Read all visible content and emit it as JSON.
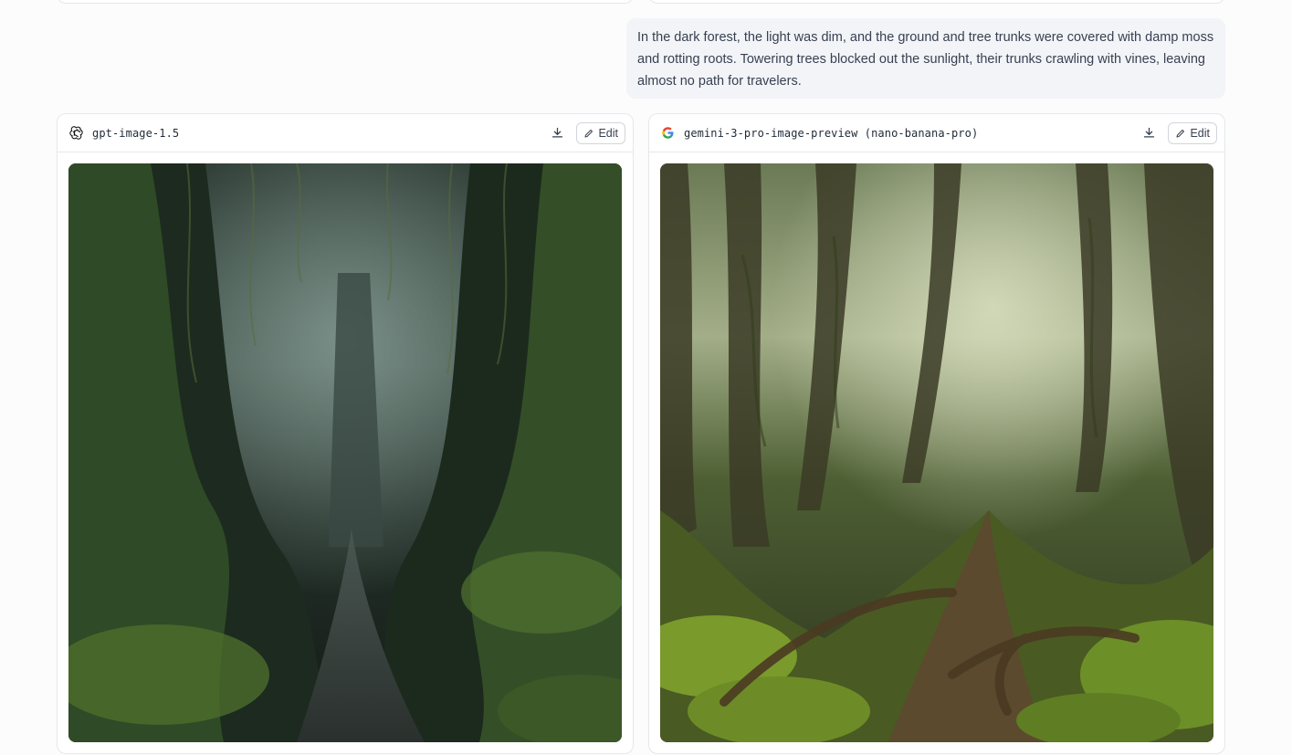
{
  "prompt": {
    "text": "In the dark forest, the light was dim, and the ground and tree trunks were covered with damp moss and rotting roots. Towering trees blocked out the sunlight, their trunks crawling with vines, leaving almost no path for travelers."
  },
  "cards": [
    {
      "model": "gpt-image-1.5",
      "logo_icon": "openai-logo-icon",
      "download_icon": "download-icon",
      "edit_label": "Edit",
      "image_desc_icon": "forest-image-dark"
    },
    {
      "model": "gemini-3-pro-image-preview (nano-banana-pro)",
      "logo_icon": "google-logo-icon",
      "download_icon": "download-icon",
      "edit_label": "Edit",
      "image_desc_icon": "forest-image-green"
    }
  ],
  "colors": {
    "bubble_bg": "#f3f4f8",
    "border": "#e5e7eb",
    "text": "#374151"
  }
}
